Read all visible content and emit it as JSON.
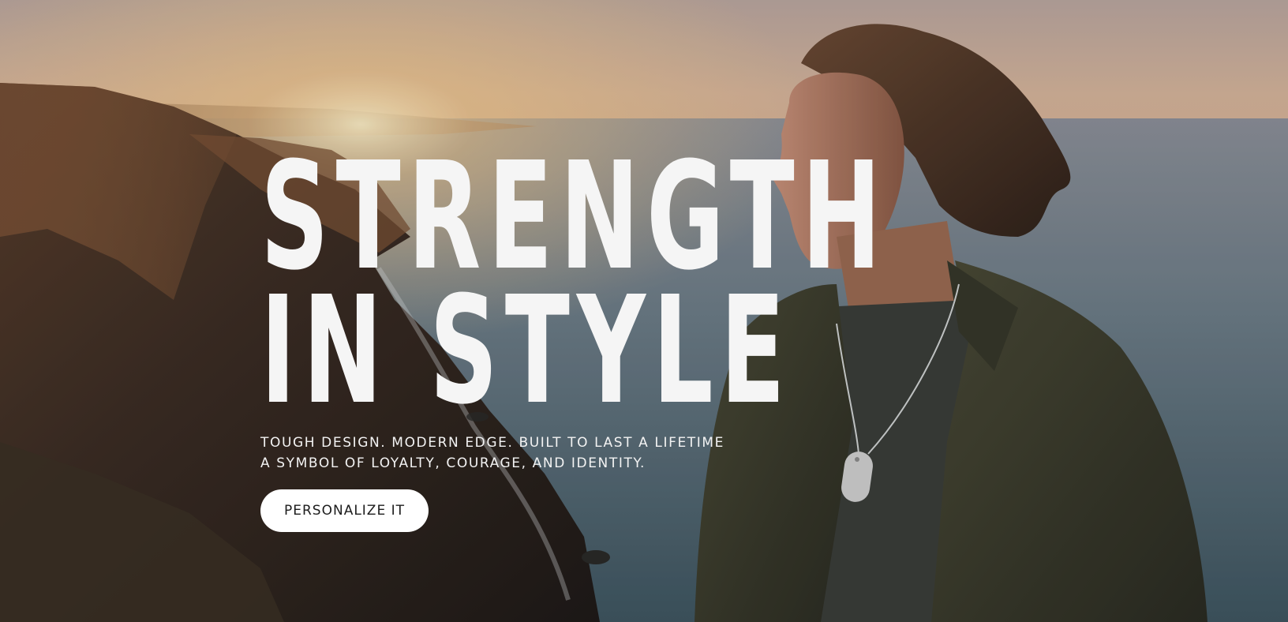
{
  "hero": {
    "headline_line1": "STRENGTH",
    "headline_line2": "IN STYLE",
    "subline1": "TOUGH DESIGN. MODERN EDGE. BUILT TO LAST A LIFETIME",
    "subline2": "A SYMBOL OF LOYALTY, COURAGE, AND IDENTITY.",
    "cta_label": "PERSONALIZE IT"
  },
  "colors": {
    "text": "#f5f5f5",
    "button_bg": "#ffffff",
    "button_text": "#1c1c1c",
    "sky": "#c9a58a",
    "sea": "#5e7480"
  }
}
